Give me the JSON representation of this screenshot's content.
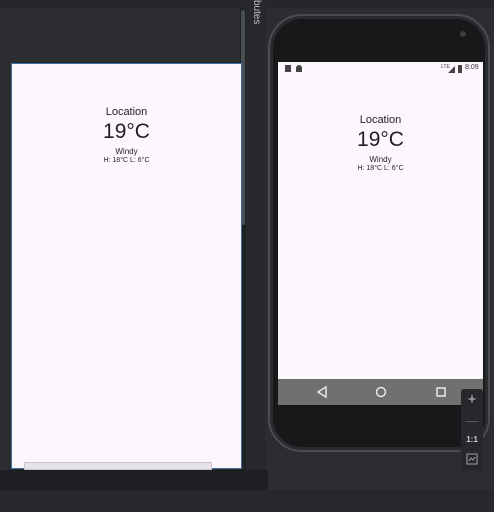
{
  "ide": {
    "vertical_tab_label": "butes"
  },
  "preview": {
    "location": "Location",
    "temperature": "19°C",
    "condition": "Windy",
    "high_low": "H: 18°C  L: 6°C"
  },
  "device": {
    "status_time": "8:09",
    "status_network": "LTE",
    "nav": {
      "back_icon": "back-triangle-icon",
      "home_icon": "home-circle-icon",
      "recents_icon": "recents-square-icon"
    }
  },
  "zoom": {
    "zoom_in": "+",
    "zoom_out": "—",
    "reset": "1:1"
  },
  "colors": {
    "surface": "#fdf7fd",
    "ide_bg": "#2b2d30",
    "nav_bar": "#707070",
    "selection_border": "#3b6ea8"
  }
}
